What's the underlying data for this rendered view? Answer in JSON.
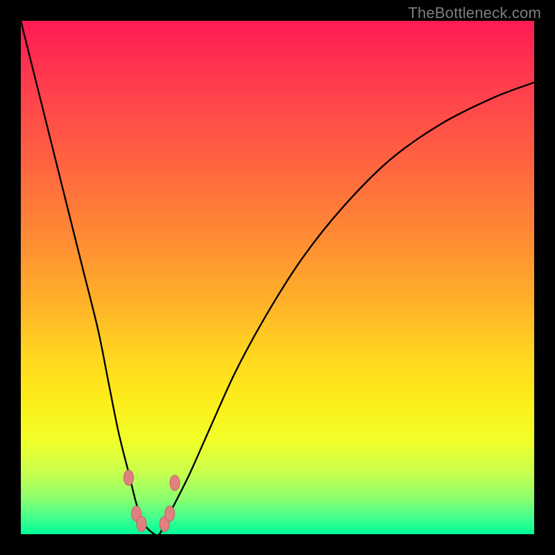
{
  "watermark": "TheBottleneck.com",
  "colors": {
    "frame": "#000000",
    "curve": "#000000",
    "marker_fill": "#e08080",
    "marker_stroke": "#c86060",
    "gradient_stops": [
      "#ff1a54",
      "#ff3c4d",
      "#ff6440",
      "#ff8a34",
      "#ffb229",
      "#ffd91f",
      "#fcf01a",
      "#f0ff2a",
      "#c8ff4d",
      "#8dff6e",
      "#3eff8e",
      "#00ff99"
    ]
  },
  "chart_data": {
    "type": "line",
    "title": "",
    "xlabel": "",
    "ylabel": "",
    "xlim": [
      0,
      100
    ],
    "ylim": [
      0,
      100
    ],
    "note": "Axes unlabeled in source image; x is a normalized horizontal index (approx. component-ratio axis on thebottleneck.com), y is bottleneck percentage (0 at bottom = no bottleneck). Values estimated from pixel positions.",
    "series": [
      {
        "name": "bottleneck-curve",
        "x": [
          0,
          3,
          6,
          9,
          12,
          15,
          17,
          19,
          21,
          22.5,
          24,
          26,
          27,
          28,
          30,
          33,
          37,
          42,
          48,
          55,
          63,
          72,
          82,
          92,
          100
        ],
        "y": [
          100,
          88,
          76,
          64,
          52,
          40,
          30,
          20,
          12,
          6,
          2,
          0,
          0,
          2,
          6,
          12,
          21,
          32,
          43,
          54,
          64,
          73,
          80,
          85,
          88
        ]
      }
    ],
    "markers": [
      {
        "x": 21.0,
        "y": 11.0
      },
      {
        "x": 22.5,
        "y": 4.0
      },
      {
        "x": 23.5,
        "y": 2.0
      },
      {
        "x": 28.0,
        "y": 2.0
      },
      {
        "x": 29.0,
        "y": 4.0
      },
      {
        "x": 30.0,
        "y": 10.0
      }
    ]
  }
}
